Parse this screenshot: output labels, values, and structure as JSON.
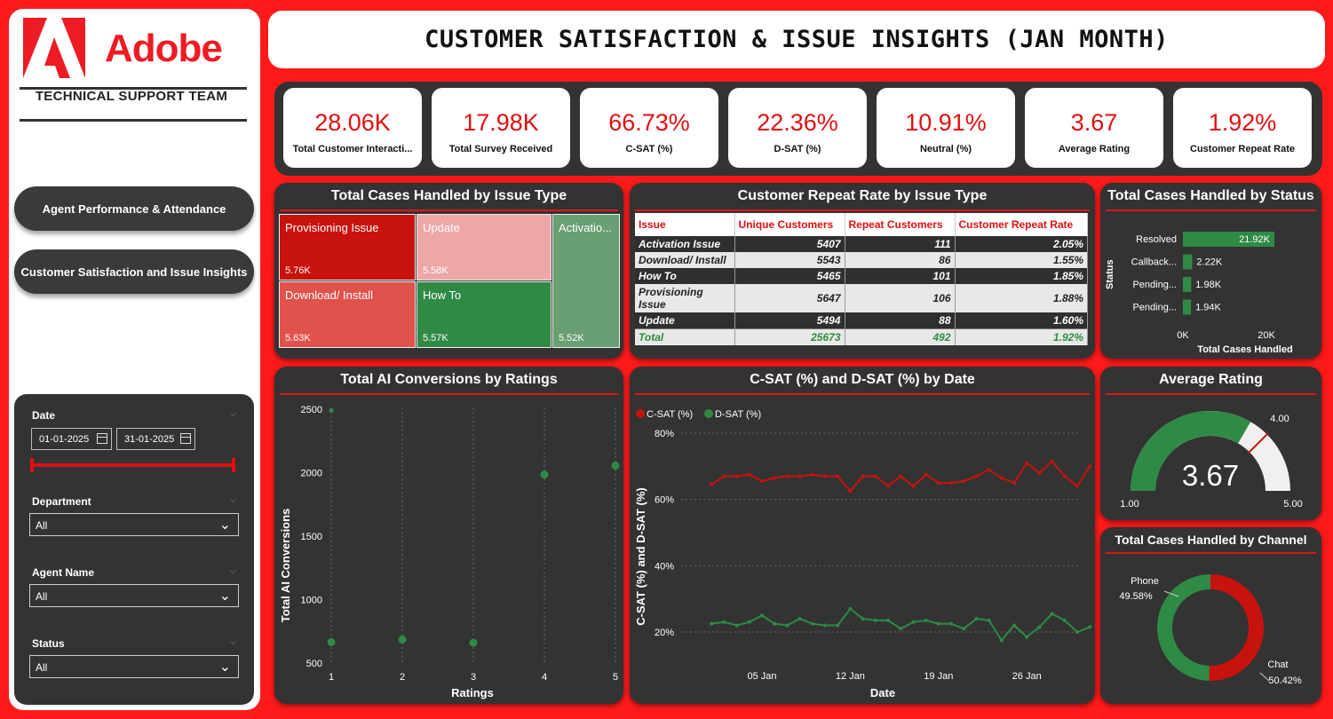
{
  "brand": {
    "name": "Adobe",
    "team": "TECHNICAL SUPPORT TEAM",
    "red": "#ed1c24"
  },
  "nav": [
    {
      "label": "Agent Performance & Attendance"
    },
    {
      "label": "Customer Satisfaction and Issue Insights"
    }
  ],
  "filters": {
    "date_label": "Date",
    "date_from": "01-01-2025",
    "date_to": "31-01-2025",
    "department_label": "Department",
    "department_value": "All",
    "agent_label": "Agent Name",
    "agent_value": "All",
    "status_label": "Status",
    "status_value": "All"
  },
  "header": {
    "title": "CUSTOMER SATISFACTION & ISSUE INSIGHTS (JAN MONTH)"
  },
  "kpis": [
    {
      "value": "28.06K",
      "label": "Total Customer Interacti..."
    },
    {
      "value": "17.98K",
      "label": "Total Survey Received"
    },
    {
      "value": "66.73%",
      "label": "C-SAT (%)"
    },
    {
      "value": "22.36%",
      "label": "D-SAT (%)"
    },
    {
      "value": "10.91%",
      "label": "Neutral (%)"
    },
    {
      "value": "3.67",
      "label": "Average Rating"
    },
    {
      "value": "1.92%",
      "label": "Customer Repeat Rate"
    }
  ],
  "treemap": {
    "title": "Total Cases Handled by Issue Type",
    "cells": [
      {
        "label": "Provisioning Issue",
        "value": "5.76K",
        "color": "#c8120e"
      },
      {
        "label": "Update",
        "value": "5.58K",
        "color": "#eda7a7"
      },
      {
        "label": "Activatio...",
        "value": "5.52K",
        "color": "#6a9e73"
      },
      {
        "label": "Download/ Install",
        "value": "5.63K",
        "color": "#e0524b"
      },
      {
        "label": "How To",
        "value": "5.57K",
        "color": "#2f8a46"
      }
    ]
  },
  "repeat_table": {
    "title": "Customer Repeat Rate by Issue Type",
    "headers": [
      "Issue",
      "Unique Customers",
      "Repeat Customers",
      "Customer Repeat Rate"
    ],
    "rows": [
      [
        "Activation Issue",
        "5407",
        "111",
        "2.05%"
      ],
      [
        "Download/ Install",
        "5543",
        "86",
        "1.55%"
      ],
      [
        "How To",
        "5465",
        "101",
        "1.85%"
      ],
      [
        "Provisioning Issue",
        "5647",
        "106",
        "1.88%"
      ],
      [
        "Update",
        "5494",
        "88",
        "1.60%"
      ]
    ],
    "total": [
      "Total",
      "25673",
      "492",
      "1.92%"
    ]
  },
  "status_chart": {
    "title": "Total Cases Handled by Status",
    "ylabel": "Status",
    "xlabel": "Total Cases Handled",
    "ticks": [
      "0K",
      "20K"
    ],
    "bars": [
      {
        "label": "Resolved",
        "value": "21.92K",
        "num": 21.92
      },
      {
        "label": "Callback...",
        "value": "2.22K",
        "num": 2.22
      },
      {
        "label": "Pending...",
        "value": "1.98K",
        "num": 1.98
      },
      {
        "label": "Pending...",
        "value": "1.94K",
        "num": 1.94
      }
    ],
    "color": "#2f8a46"
  },
  "scatter": {
    "title": "Total AI Conversions by Ratings",
    "xlabel": "Ratings",
    "ylabel": "Total AI Conversions"
  },
  "line": {
    "title": "C-SAT (%) and D-SAT (%) by Date",
    "xlabel": "Date",
    "ylabel": "C-SAT (%) and D-SAT (%)",
    "legend": [
      "C-SAT (%)",
      "D-SAT (%)"
    ]
  },
  "gauge": {
    "title": "Average Rating",
    "value_text": "3.67",
    "min_text": "1.00",
    "max_text": "5.00",
    "target_text": "4.00"
  },
  "donut": {
    "title": "Total Cases Handled by Channel",
    "phone_label": "Phone",
    "phone_value": "49.58%",
    "chat_label": "Chat",
    "chat_value": "50.42%"
  },
  "chart_data": [
    {
      "type": "scatter",
      "title": "Total AI Conversions by Ratings",
      "xlabel": "Ratings",
      "ylabel": "Total AI Conversions",
      "x": [
        1,
        2,
        3,
        4,
        5
      ],
      "y": [
        665,
        685,
        660,
        1985,
        2055
      ],
      "extra_point": {
        "x": 1,
        "y": 2490
      },
      "xlim": [
        1,
        5
      ],
      "ylim": [
        500,
        2500
      ],
      "yticks": [
        500,
        1000,
        1500,
        2000,
        2500
      ],
      "color": "#2f8a46"
    },
    {
      "type": "line",
      "title": "C-SAT (%) and D-SAT (%) by Date",
      "xlabel": "Date",
      "ylabel": "C-SAT (%) and D-SAT (%)",
      "x": [
        "2025-01-01",
        "2025-01-02",
        "2025-01-03",
        "2025-01-04",
        "2025-01-05",
        "2025-01-06",
        "2025-01-07",
        "2025-01-08",
        "2025-01-09",
        "2025-01-10",
        "2025-01-11",
        "2025-01-12",
        "2025-01-13",
        "2025-01-14",
        "2025-01-15",
        "2025-01-16",
        "2025-01-17",
        "2025-01-18",
        "2025-01-19",
        "2025-01-20",
        "2025-01-21",
        "2025-01-22",
        "2025-01-23",
        "2025-01-24",
        "2025-01-25",
        "2025-01-26",
        "2025-01-27",
        "2025-01-28",
        "2025-01-29",
        "2025-01-30",
        "2025-01-31"
      ],
      "xticks": [
        "05 Jan",
        "12 Jan",
        "19 Jan",
        "26 Jan"
      ],
      "xtick_days": [
        5,
        12,
        19,
        26
      ],
      "ylim": [
        15,
        80
      ],
      "yticks": [
        20,
        40,
        60,
        80
      ],
      "series": [
        {
          "name": "C-SAT (%)",
          "color": "#c8120e",
          "values": [
            64.5,
            67,
            67,
            67.5,
            65.5,
            66.5,
            67,
            67,
            67.5,
            67,
            67,
            62.5,
            67,
            67,
            64,
            67,
            64,
            67.5,
            65,
            65,
            65.5,
            67,
            69,
            66.5,
            65,
            71,
            68,
            71.5,
            67,
            64,
            70
          ]
        },
        {
          "name": "D-SAT (%)",
          "color": "#2f8a46",
          "values": [
            22.5,
            23,
            22,
            23,
            25,
            22.5,
            22,
            24,
            22.5,
            22,
            22,
            27,
            24,
            23.5,
            23.5,
            21,
            23,
            23.5,
            22.5,
            22.5,
            21,
            24,
            23.5,
            17.5,
            22,
            18.5,
            21.5,
            25.5,
            23.5,
            20,
            21.5
          ]
        }
      ]
    },
    {
      "type": "bar",
      "title": "Total Cases Handled by Status",
      "categories": [
        "Resolved",
        "Callback...",
        "Pending...",
        "Pending..."
      ],
      "values": [
        21.92,
        2.22,
        1.98,
        1.94
      ],
      "xlabel": "Total Cases Handled",
      "ylabel": "Status"
    },
    {
      "type": "pie",
      "title": "Total Cases Handled by Channel",
      "categories": [
        "Phone",
        "Chat"
      ],
      "values": [
        49.58,
        50.42
      ],
      "colors": [
        "#2f8a46",
        "#c8120e"
      ]
    },
    {
      "type": "gauge",
      "title": "Average Rating",
      "value": 3.67,
      "min": 1.0,
      "max": 5.0,
      "target": 4.0
    }
  ]
}
